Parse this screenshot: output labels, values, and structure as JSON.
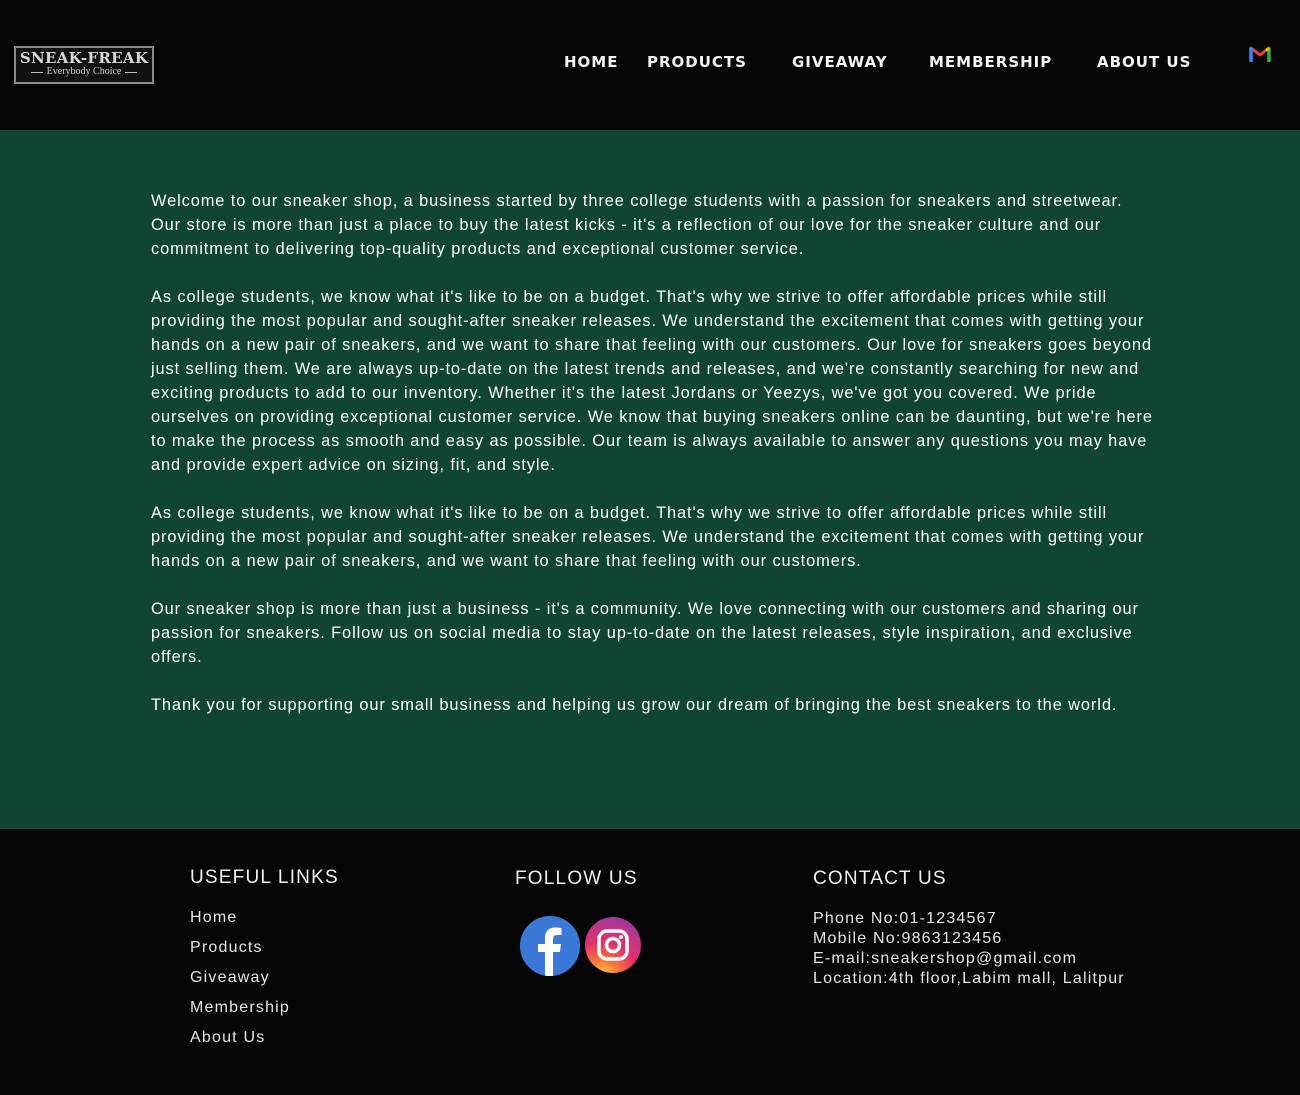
{
  "header": {
    "logo": {
      "brand": "SNEAK-FREAK",
      "tagline": "Everybody Choice"
    },
    "nav": [
      "HOME",
      "PRODUCTS",
      "GIVEAWAY",
      "MEMBERSHIP",
      "ABOUT US"
    ],
    "mail_icon": "gmail-icon"
  },
  "about": {
    "paragraphs": [
      "Welcome to our sneaker shop, a business started by three college students with a passion for sneakers and streetwear. Our store is more than just a place to buy the latest kicks - it's a reflection of our love for the sneak­er culture and our commitment to delivering top-quality products and exceptional customer service.",
      "As college students, we know what it's like to be on a budget. That's why we strive to offer affordable prices while still providing the most popular and sought-after sneaker releases. We understand the excitement that comes with getting your hands on a new pair of sneakers, and we want to share that feeling with our customers. Our love for sneakers goes beyond just selling them. We are always up-to-date on the latest trends and releas­es, and we're constantly searching for new and exciting products to add to our inventory. Whether it's the latest Jordans or Yeezys, we've got you covered. We pride ourselves on providing exceptional customer service. We know that buying sneakers online can be daunting, but we're here to make the process as smooth and easy as possible. Our team is always available to answer any questions you may have and provide expert advice on sizing, fit, and style.",
      "As college students, we know what it's like to be on a budget. That's why we strive to offer affordable prices while still providing the most popular and sought-after sneaker releases. We understand the excitement that comes with getting your hands on a new pair of sneakers, and we want to share that feeling with our customers.",
      "Our sneaker shop is more than just a business - it's a community. We love connecting with our customers and sharing our passion for sneakers. Follow us on social media to stay up-to-date on the latest releases, style inspi­ration, and exclusive offers.",
      "Thank you for supporting our small business and helping us grow our dream of bringing the best sneakers to the world."
    ]
  },
  "footer": {
    "useful_links": {
      "title": "USEFUL LINKS",
      "items": [
        "Home",
        "Products",
        "Giveaway",
        "Membership",
        "About Us"
      ]
    },
    "follow_us": {
      "title": "FOLLOW US",
      "icons": [
        "facebook-icon",
        "instagram-icon"
      ]
    },
    "contact_us": {
      "title": "CONTACT US",
      "phone": "Phone No:01-1234567",
      "mobile": "Mobile No:9863123456",
      "email": "E-mail:sneakershop@gmail.com",
      "location": "Location:4th floor,Labim mall, Lalitpur"
    }
  },
  "colors": {
    "header_bg": "#050505",
    "main_bg": "#0f4532",
    "footer_bg": "#050505",
    "facebook": "#3b78d8"
  }
}
